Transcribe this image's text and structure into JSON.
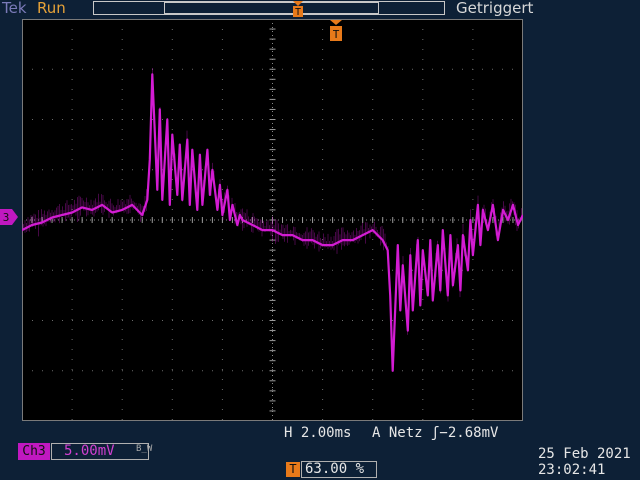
{
  "header": {
    "brand": "Tek",
    "run_state": "Run",
    "trigger_state": "Getriggert"
  },
  "channel": {
    "marker": "3",
    "label": "Ch3",
    "scale": "5.00mV",
    "bw_icon": "B_W",
    "color": "#d31cd3"
  },
  "trigger_position_icon": "T",
  "horizontal": {
    "timebase": "H 2.00ms",
    "trigger_readout": "A  Netz ʃ−2.68mV",
    "trigger_position": "63.00 %"
  },
  "timestamp": {
    "date": "25 Feb  2021",
    "time": "23:02:41"
  },
  "icons": [
    "channel-marker-icon",
    "trigger-position-icon",
    "bandwidth-limit-icon"
  ],
  "chart_data": {
    "type": "line",
    "grid": true,
    "x_divisions": 10,
    "y_divisions": 8,
    "ylim_div": [
      -4,
      4
    ],
    "xlim_div": [
      0,
      10
    ],
    "series": [
      {
        "x": [
          0,
          0.2,
          0.4,
          0.6,
          0.8,
          1.0,
          1.2,
          1.4,
          1.6,
          1.8,
          2.0,
          2.2,
          2.4,
          2.5,
          2.55,
          2.6,
          2.7,
          2.75,
          2.8,
          2.9,
          2.95,
          3.0,
          3.1,
          3.15,
          3.2,
          3.3,
          3.35,
          3.4,
          3.5,
          3.55,
          3.6,
          3.7,
          3.75,
          3.8,
          3.9,
          3.95,
          4.0,
          4.1,
          4.15,
          4.2,
          4.3,
          4.35,
          4.4,
          4.6,
          4.8,
          5.0,
          5.2,
          5.4,
          5.6,
          5.8,
          6.0,
          6.2,
          6.4,
          6.6,
          6.8,
          7.0,
          7.2,
          7.3,
          7.35,
          7.4,
          7.5,
          7.55,
          7.6,
          7.7,
          7.75,
          7.8,
          7.9,
          7.95,
          8.0,
          8.1,
          8.15,
          8.2,
          8.3,
          8.35,
          8.4,
          8.5,
          8.55,
          8.6,
          8.7,
          8.75,
          8.8,
          8.9,
          8.95,
          9.0,
          9.1,
          9.15,
          9.2,
          9.3,
          9.4,
          9.5,
          9.6,
          9.7,
          9.8,
          9.9,
          10.0
        ],
        "y": [
          -0.2,
          -0.1,
          -0.05,
          0.05,
          0.1,
          0.15,
          0.25,
          0.2,
          0.3,
          0.15,
          0.2,
          0.3,
          0.1,
          0.4,
          1.2,
          2.9,
          0.6,
          2.2,
          0.4,
          2.0,
          0.3,
          1.7,
          0.5,
          1.5,
          0.4,
          1.6,
          0.3,
          1.4,
          0.2,
          1.3,
          0.3,
          1.4,
          0.5,
          1.0,
          0.2,
          0.7,
          0.1,
          0.6,
          0.0,
          0.3,
          -0.1,
          0.1,
          0.0,
          -0.1,
          -0.2,
          -0.2,
          -0.3,
          -0.3,
          -0.4,
          -0.4,
          -0.5,
          -0.5,
          -0.4,
          -0.4,
          -0.3,
          -0.2,
          -0.4,
          -0.6,
          -1.5,
          -3.0,
          -0.5,
          -1.8,
          -0.9,
          -2.2,
          -0.7,
          -1.8,
          -0.4,
          -1.7,
          -0.6,
          -1.5,
          -0.4,
          -1.6,
          -0.5,
          -1.4,
          -0.2,
          -1.5,
          -0.3,
          -1.3,
          -0.5,
          -1.4,
          -0.3,
          -1.0,
          0.0,
          -0.7,
          0.3,
          -0.5,
          0.2,
          -0.2,
          0.3,
          -0.4,
          0.2,
          0.0,
          0.3,
          -0.1,
          0.1
        ]
      }
    ]
  }
}
